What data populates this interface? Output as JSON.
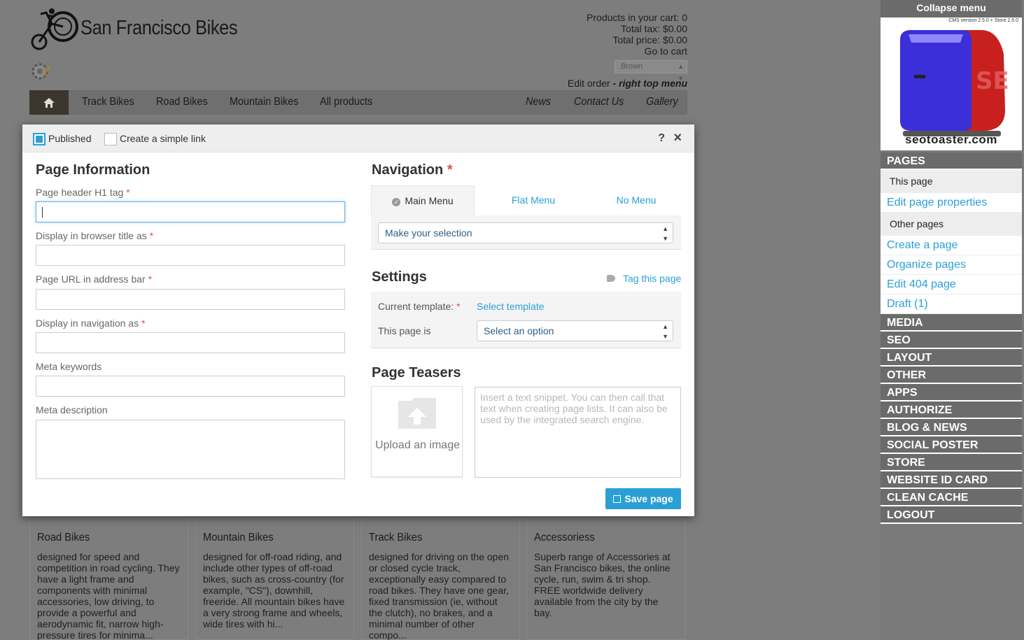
{
  "site": {
    "title": "San Francisco Bikes",
    "cart": {
      "products": "Products in your cart: 0",
      "tax": "Total tax: $0.00",
      "price": "Total price: $0.00",
      "go": "Go to cart"
    },
    "theme_select": "Brown",
    "edit_order": "Edit order",
    "edit_order_hint": "- right top menu",
    "nav": {
      "left": [
        "Track Bikes",
        "Road Bikes",
        "Mountain Bikes",
        "All products"
      ],
      "right": [
        "News",
        "Contact Us",
        "Gallery"
      ]
    },
    "cards": [
      {
        "title": "Road Bikes",
        "text": "designed for speed and competition in road cycling. They have a light frame and components with minimal accessories, low driving, to provide a powerful and aerodynamic fit, narrow high-pressure tires for minima..."
      },
      {
        "title": "Mountain Bikes",
        "text": "designed for off-road riding, and include other types of off-road bikes, such as cross-country (for example, \"CS\"), downhill, freeride. All mountain bikes have a very strong frame and wheels, wide tires with hi..."
      },
      {
        "title": "Track Bikes",
        "text": "designed for driving on the open or closed cycle track, exceptionally easy compared to road bikes. They have one gear, fixed transmission (ie, without the clutch), no brakes, and a minimal number of other compo..."
      },
      {
        "title": "Accessoriess",
        "text": "Superb range of Accessories at San Francisco bikes, the online cycle, run, swim & tri shop. FREE worldwide delivery available from the city by the bay."
      }
    ]
  },
  "dialog": {
    "published": "Published",
    "simple_link": "Create a simple link",
    "help": "?",
    "close": "×",
    "page_info": {
      "heading": "Page Information",
      "h1_label": "Page header H1 tag",
      "title_label": "Display in browser title as",
      "url_label": "Page URL in address bar",
      "nav_label": "Display in navigation as",
      "keywords_label": "Meta keywords",
      "description_label": "Meta description",
      "required_mark": "*"
    },
    "navigation": {
      "heading": "Navigation",
      "tabs": [
        "Main Menu",
        "Flat Menu",
        "No Menu"
      ],
      "select": "Make your selection"
    },
    "settings": {
      "heading": "Settings",
      "tag_link": "Tag this page",
      "template_label": "Current template:",
      "template_link": "Select template",
      "page_is_label": "This page is",
      "page_is_select": "Select an option"
    },
    "teasers": {
      "heading": "Page Teasers",
      "upload": "Upload an image",
      "placeholder": "Insert a text snippet. You can then call that text when creating page lists. It can also be used by the integrated search engine."
    },
    "save": "Save page"
  },
  "panel": {
    "collapse": "Collapse menu",
    "version": "CMS version 2.5.0 + Store 2.5.0",
    "brand": "seotoaster.com",
    "pages_heading": "PAGES",
    "this_page": "This page",
    "edit_props": "Edit page properties",
    "other_pages": "Other pages",
    "links": [
      "Create a page",
      "Organize pages",
      "Edit 404 page",
      "Draft (1)"
    ],
    "sections": [
      "MEDIA",
      "SEO",
      "LAYOUT",
      "OTHER",
      "APPS",
      "AUTHORIZE",
      "BLOG & NEWS",
      "SOCIAL POSTER",
      "STORE",
      "WEBSITE ID CARD",
      "CLEAN CACHE",
      "LOGOUT"
    ]
  },
  "colors": {
    "accent": "#2a9fd6",
    "panel_dark": "#6b6b6b",
    "overlay": "#7d7d7d"
  }
}
